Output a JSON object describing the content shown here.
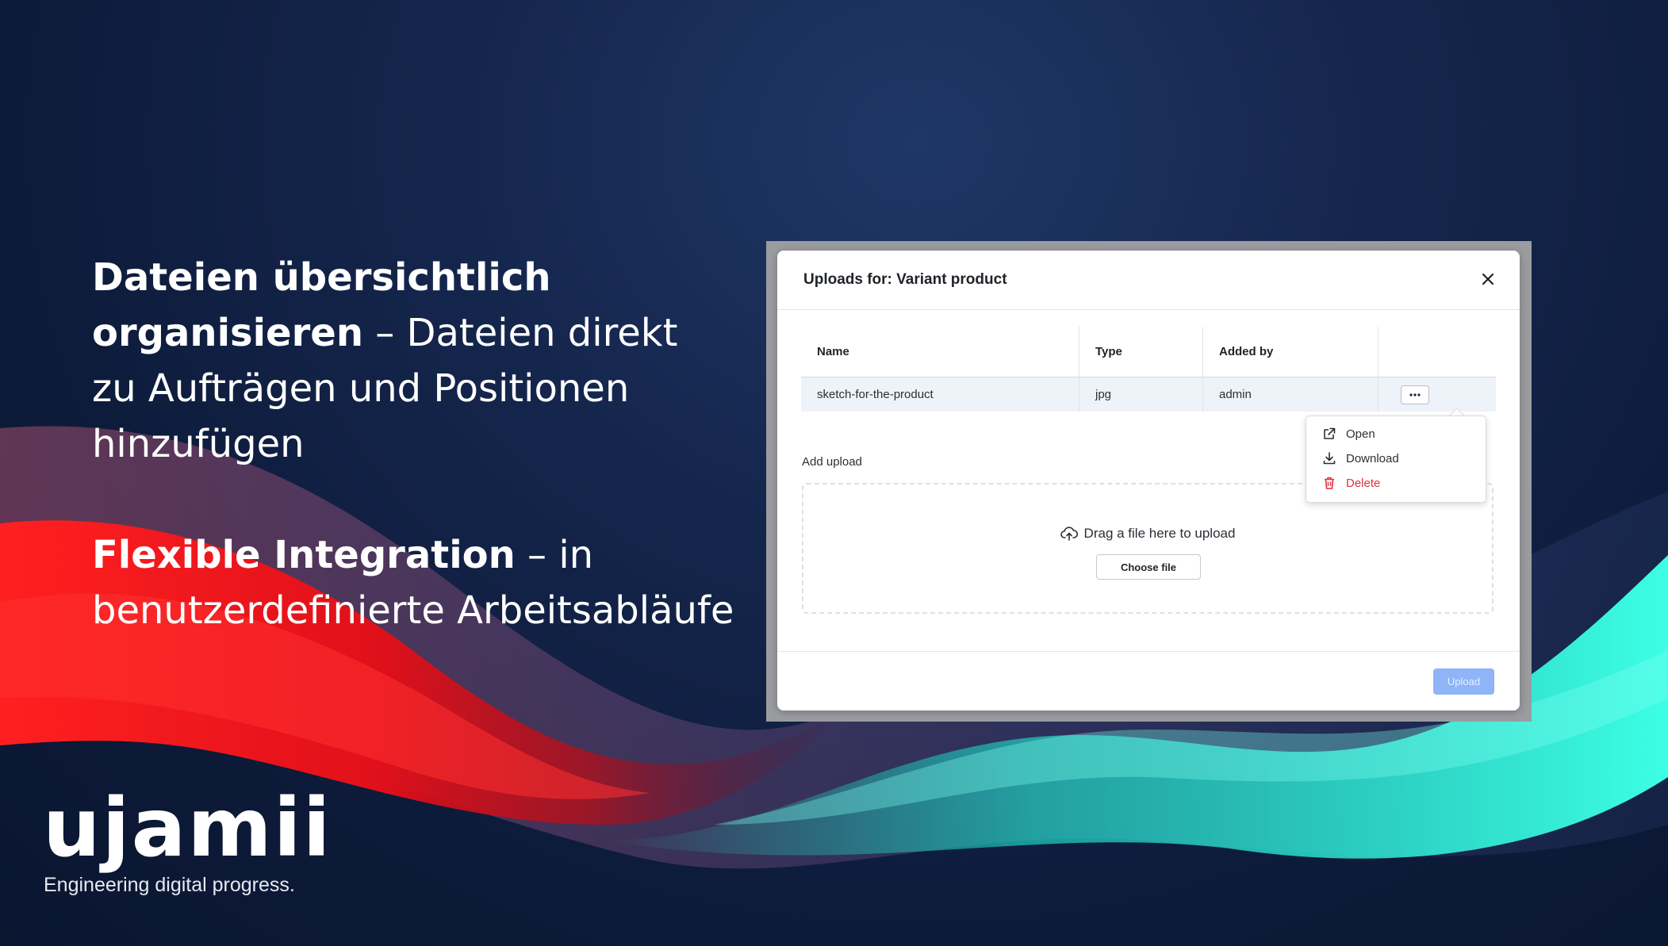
{
  "slide": {
    "block1": {
      "bold_line1": "Dateien übersichtlich",
      "bold_line2": "organisieren",
      "rest_line2": " – Dateien direkt",
      "line3": "zu Aufträgen und Positionen",
      "line4": "hinzufügen"
    },
    "block2": {
      "bold": "Flexible Integration",
      "rest_line1": " – in",
      "line2": "benutzerdefinierte Arbeitsabläufe"
    },
    "logo": {
      "wordmark": "ujamii",
      "tagline": "Engineering digital progress."
    }
  },
  "dialog": {
    "title": "Uploads for: Variant product",
    "close_icon": "close-icon",
    "table": {
      "headers": [
        "Name",
        "Type",
        "Added by",
        ""
      ],
      "rows": [
        {
          "name": "sketch-for-the-product",
          "type": "jpg",
          "added_by": "admin"
        }
      ]
    },
    "add_upload_label": "Add upload",
    "drop_text": "Drag a file here to upload",
    "choose_file_label": "Choose file",
    "upload_label": "Upload",
    "context_menu": {
      "items": [
        {
          "label": "Open",
          "icon": "external-link-icon"
        },
        {
          "label": "Download",
          "icon": "download-icon"
        },
        {
          "label": "Delete",
          "icon": "trash-icon",
          "color": "#e0323c"
        }
      ]
    }
  },
  "colors": {
    "background": "#0d1b3a",
    "accent_red": "#ff1a1a",
    "accent_teal": "#2ff0d8",
    "primary_disabled": "#8fb4f7",
    "danger": "#e0323c"
  }
}
